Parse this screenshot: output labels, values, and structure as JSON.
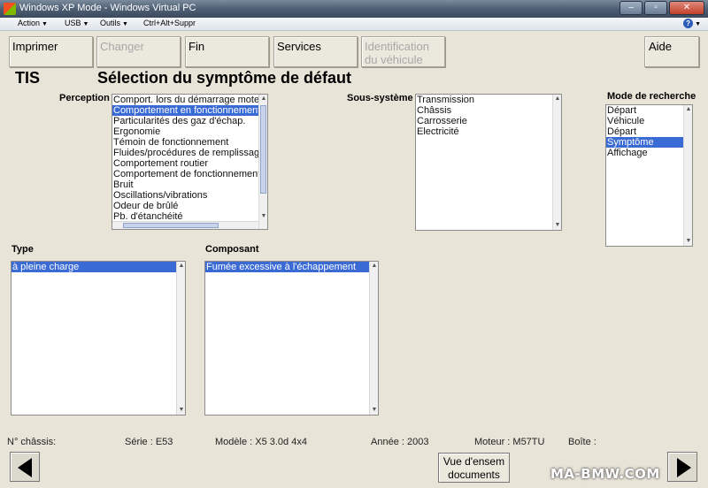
{
  "window": {
    "title": "Windows XP Mode - Windows Virtual PC"
  },
  "menubar": {
    "items": [
      {
        "label": "Action"
      },
      {
        "label": "USB"
      },
      {
        "label": "Outils"
      },
      {
        "label": "Ctrl+Alt+Suppr"
      }
    ]
  },
  "toolbar": {
    "imprimer": "Imprimer",
    "changer": "Changer",
    "fin": "Fin",
    "services": "Services",
    "identification_line1": "Identification",
    "identification_line2": "du véhicule",
    "aide": "Aide"
  },
  "header": {
    "app": "TIS",
    "title": "Sélection du symptôme de défaut"
  },
  "perception": {
    "label": "Perception",
    "items": [
      "Comport. lors du démarrage moteur",
      "Comportement en fonctionnement (",
      "Particularités des gaz d'échap.",
      "Ergonomie",
      "Témoin de fonctionnement",
      "Fluides/procédures de remplissage",
      "Comportement routier",
      "Comportement de fonctionnement",
      "Bruit",
      "Oscillations/vibrations",
      "Odeur de brûlé",
      "Pb. d'étanchéité"
    ],
    "selected_index": 1
  },
  "sous_systeme": {
    "label": "Sous-système",
    "items": [
      "Transmission",
      "Châssis",
      "Carrosserie",
      "Electricité"
    ]
  },
  "mode_recherche": {
    "label": "Mode de recherche",
    "items": [
      "Départ",
      "Véhicule",
      "Départ",
      "Symptôme",
      "Affichage"
    ],
    "selected_index": 3
  },
  "type": {
    "label": "Type",
    "items": [
      "à pleine charge"
    ],
    "selected_index": 0
  },
  "composant": {
    "label": "Composant",
    "items": [
      "Fumée excessive à l'échappement"
    ],
    "selected_index": 0
  },
  "status": {
    "chassis": "N° châssis:",
    "serie": "Série : E53",
    "modele": "Modèle : X5 3.0d 4x4",
    "annee": "Année : 2003",
    "moteur": "Moteur : M57TU",
    "boite": "Boîte :"
  },
  "footer": {
    "vue_line1": "Vue d'ensem",
    "vue_line2": "documents",
    "watermark": "MA-BMW.COM"
  }
}
